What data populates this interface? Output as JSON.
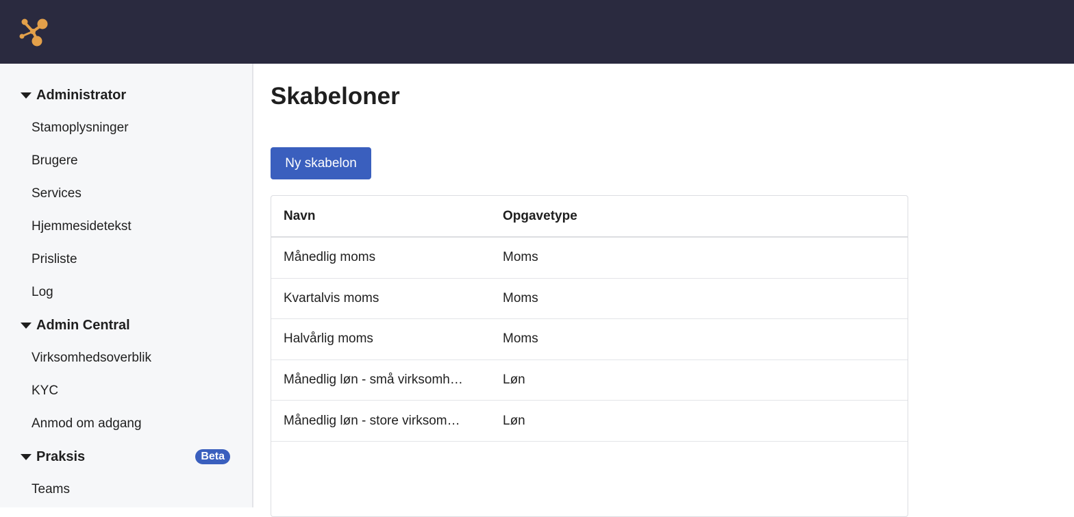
{
  "header": {
    "logo_color": "#e3a04a",
    "background": "#2a2a3f"
  },
  "sidebar": {
    "sections": [
      {
        "title": "Administrator",
        "items": [
          "Stamoplysninger",
          "Brugere",
          "Services",
          "Hjemmesidetekst",
          "Prisliste",
          "Log"
        ]
      },
      {
        "title": "Admin Central",
        "items": [
          "Virksomhedsoverblik",
          "KYC",
          "Anmod om adgang"
        ]
      },
      {
        "title": "Praksis",
        "badge": "Beta",
        "items": [
          "Teams"
        ]
      }
    ]
  },
  "main": {
    "title": "Skabeloner",
    "new_button_label": "Ny skabelon",
    "table": {
      "headers": [
        "Navn",
        "Opgavetype"
      ],
      "rows": [
        [
          "Månedlig moms",
          "Moms"
        ],
        [
          "Kvartalvis moms",
          "Moms"
        ],
        [
          "Halvårlig moms",
          "Moms"
        ],
        [
          "Månedlig løn - små virksomh…",
          "Løn"
        ],
        [
          "Månedlig løn - store virksom…",
          "Løn"
        ]
      ]
    }
  },
  "colors": {
    "accent": "#3a5fbe",
    "sidebar_bg": "#f6f7f9"
  }
}
